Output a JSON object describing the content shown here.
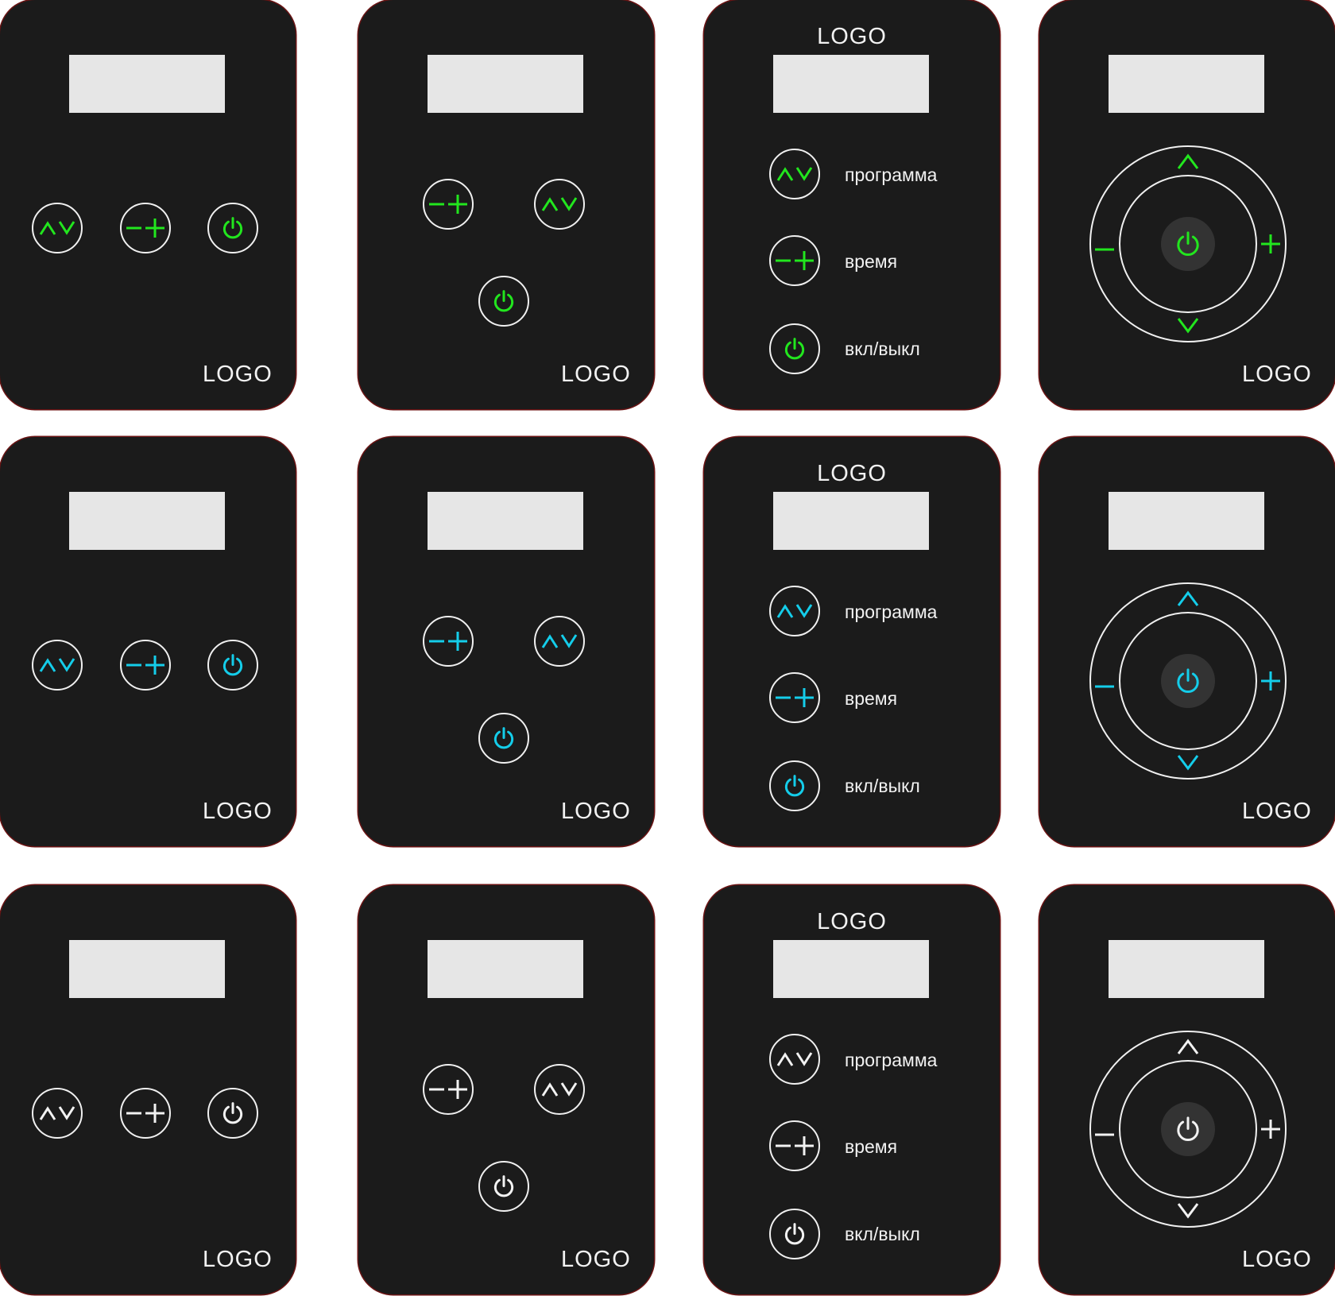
{
  "logo_text": "LOGO",
  "labels": {
    "program": "программа",
    "time": "время",
    "power": "вкл/выкл"
  },
  "icons": {
    "mode": "up-down-icon",
    "adjust": "minus-plus-icon",
    "power": "power-icon",
    "up": "chevron-up-icon",
    "down": "chevron-down-icon",
    "minus": "minus-icon",
    "plus": "plus-icon"
  },
  "colors": {
    "panel": "#1b1b1b",
    "display": "#e6e6e6",
    "green": "#22e61e",
    "cyan": "#14cdea",
    "white": "#f2f2f2",
    "outline": "#f0f0f0",
    "center_button": "#333333"
  },
  "rows": [
    {
      "accent": "green"
    },
    {
      "accent": "cyan"
    },
    {
      "accent": "white"
    }
  ]
}
